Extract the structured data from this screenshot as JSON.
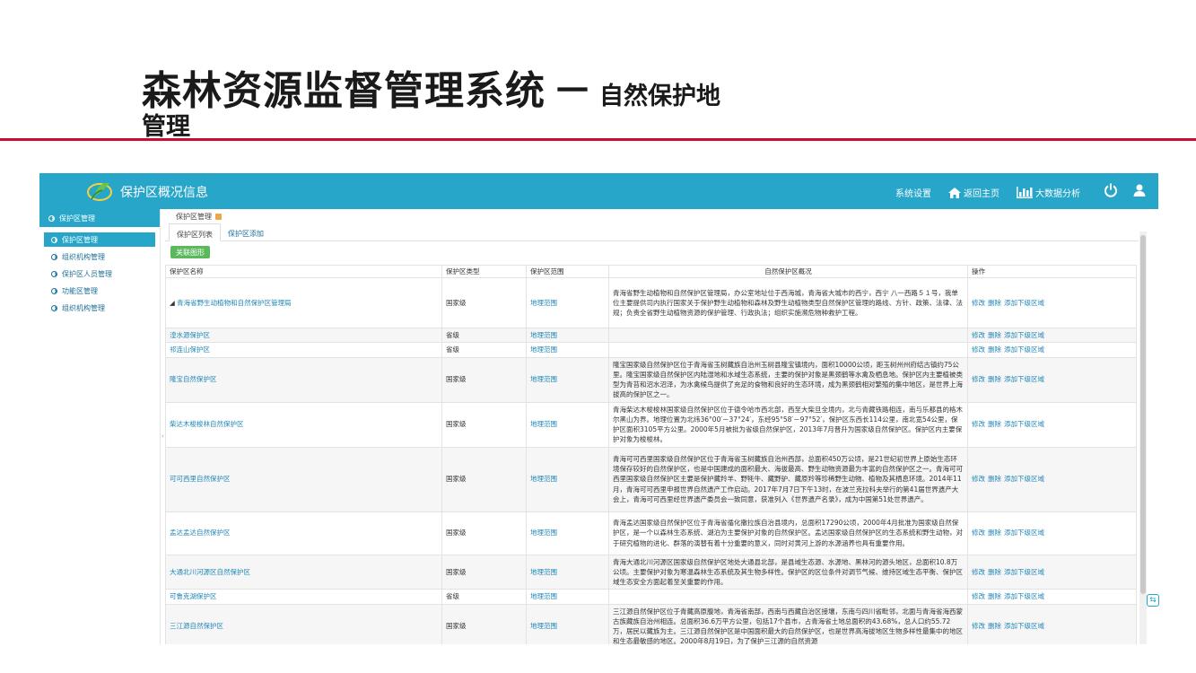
{
  "slide": {
    "title_main": "森林资源监督管理系统",
    "title_dash": "－",
    "title_sub": "自然保护地",
    "title_sub2": "管理"
  },
  "app": {
    "title": "保护区概况信息",
    "header_links": {
      "settings": "系统设置",
      "home": "返回主页",
      "bigdata": "大数据分析"
    },
    "icons": {
      "home": "home-icon",
      "bigdata": "bar-chart-icon",
      "power": "power-icon",
      "user": "user-icon"
    },
    "colors": {
      "header": "#27a6c9",
      "link": "#1e86b8",
      "green": "#5cb85c",
      "slide_line": "#c8102e"
    }
  },
  "sidebar": {
    "top": "保护区管理",
    "items": [
      {
        "label": "保护区管理"
      },
      {
        "label": "组织机构管理"
      },
      {
        "label": "保护区人员管理"
      },
      {
        "label": "功能区管理"
      },
      {
        "label": "组织机构管理"
      }
    ]
  },
  "main": {
    "breadcrumb": "保护区管理",
    "tabs": [
      "保护区列表",
      "保护区添加"
    ],
    "button": "关联图形",
    "columns": [
      "保护区名称",
      "保护区类型",
      "保护区范围",
      "自然保护区概况",
      "操作"
    ],
    "range_link": "地理范围",
    "ops": [
      "修改",
      "删除",
      "添加下级区域"
    ],
    "rows": [
      {
        "name": "青海省野生动植物和自然保护区管理局",
        "type": "国家级",
        "desc": "青海省野生动植物和自然保护区管理局，办公室地址位于西海城，青海省大城市的西宁，西宁 八一西路５１号，我单位主要提供司内执行国家关于保护野生动植物和森林及野生动植物类型自然保护区管理的路线、方针、政策、法律、法规；负责全省野生动植物资源的保护管理、行政执法；组织实施濒危物种救护工程。"
      },
      {
        "name": "湟水源保护区",
        "type": "省级",
        "desc": ""
      },
      {
        "name": "祁连山保护区",
        "type": "省级",
        "desc": ""
      },
      {
        "name": "隆宝自然保护区",
        "type": "国家级",
        "desc": "隆宝国家级自然保护区位于青海省玉树藏族自治州玉树县隆宝镇境内，面积10000公顷，距玉树州州府结古镇约75公里。隆宝国家级自然保护区内陆湿地和水域生态系统，主要的保护对象是黑颈鹤等水禽及栖息地。保护区内主要植被类型为青苔和沼水沼泽，为水禽候鸟提供了充足的食物和良好的生态环境，成为黑颈鹤相对繁殖的集中地区，是世界上海拔高的保护区之一。"
      },
      {
        "name": "柴达木梭梭林自然保护区",
        "type": "国家级",
        "desc": "青海柴达木梭梭林国家级自然保护区位于德令哈市西北部，西至大柴旦全境内，北与青藏铁路相连，南与乐都县的格木尔黑山为界。地理位置为北纬36°00′－37°24′，东经95°58′－97°52′，保护区东西长114公里，南北宽54公里，保护区面积3105平方公里。2000年5月被批为省级自然保护区，2013年7月晋升为国家级自然保护区。保护区内主要保护对象为梭梭林。"
      },
      {
        "name": "可可西里自然保护区",
        "type": "国家级",
        "desc": "青海可可西里国家级自然保护区位于青海省玉树藏族自治州西部，总面积450万公顷，是21世纪初世界上原始生态环境保存较好的自然保护区，也是中国建成的面积最大、海拔最高、野生动物资源最为丰富的自然保护区之一。青海可可西里国家级自然保护区主要是保护藏羚羊、野牦牛、藏野驴、藏原羚等珍稀野生动物、植物及其栖息环境。2014年11月，青海可可西里申报世界自然遗产工作启动。2017年7月7日下午13时，在波兰克拉科夫举行的第41届世界遗产大会上，青海可可西里经世界遗产委员会一致同意，获准列入《世界遗产名录》，成为中国第51处世界遗产。"
      },
      {
        "name": "孟达孟达自然保护区",
        "type": "国家级",
        "desc": "青海孟达国家级自然保护区位于青海省循化撒拉族自治县境内，总面积17290公顷，2000年4月批准为国家级自然保护区，是一个以森林生态系统、湖泊为主要保护对象的自然保护区。孟达国家级自然保护区的生态系统和野生动物，对于研究植物的进化、群落的演替有着十分重要的意义，同时对黄河上游的水源涵养也具有重要作用。"
      },
      {
        "name": "大通北川河源区自然保护区",
        "type": "国家级",
        "desc": "青海大通北川河源区国家级自然保护区地处大通县北部，是县域生态源、水源地、黑林河的源头地区，总面积10.8万公顷。主要保护对象为寒温森林生态系统及其生物多样性。保护区的区位条件对调节气候、维持区域生态平衡、保护区域生态安全方面起着至关重要的作用。"
      },
      {
        "name": "可鲁克湖保护区",
        "type": "省级",
        "desc": ""
      },
      {
        "name": "三江源自然保护区",
        "type": "国家级",
        "desc": "三江源自然保护区位于青藏高原腹地，青海省南部，西南与西藏自治区接壤，东南与四川省毗邻，北面与青海省海西蒙古族藏族自治州相连。总面积36.6万平方公里，包括17个县市，占青海省土地总面积的43.68%，总人口约55.72万，居民以藏族为主。三江源自然保护区是中国面积最大的自然保护区，也是世界高海拔地区生物多样性最集中的地区和生态最敏感的地区。2000年8月19日，为了保护三江源的自然资源"
      }
    ]
  }
}
